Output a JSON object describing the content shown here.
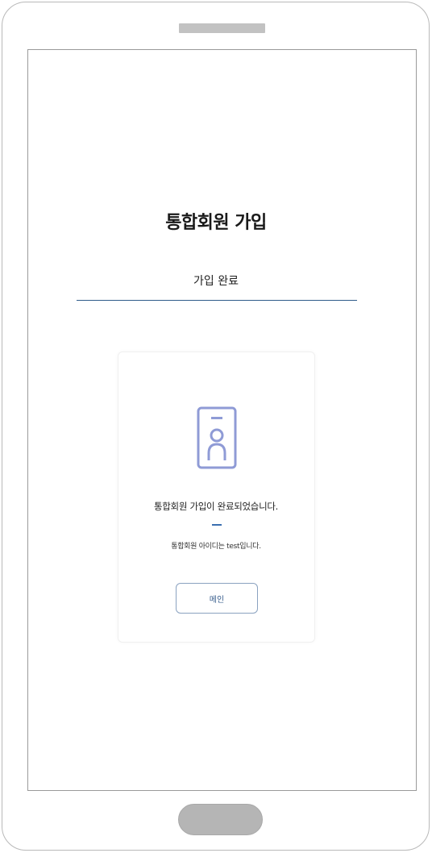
{
  "signup": {
    "title": "통합회원 가입",
    "step_label": "가입 완료",
    "complete_message": "통합회원 가입이 완료되었습니다.",
    "id_message": "통합회원 아이디는 test입니다.",
    "main_button_label": "메인"
  },
  "icons": {
    "card_icon": "id-card-icon"
  },
  "colors": {
    "accent": "#2f5b8a",
    "icon": "#8f9bd6",
    "button_text": "#3a5f8e"
  }
}
